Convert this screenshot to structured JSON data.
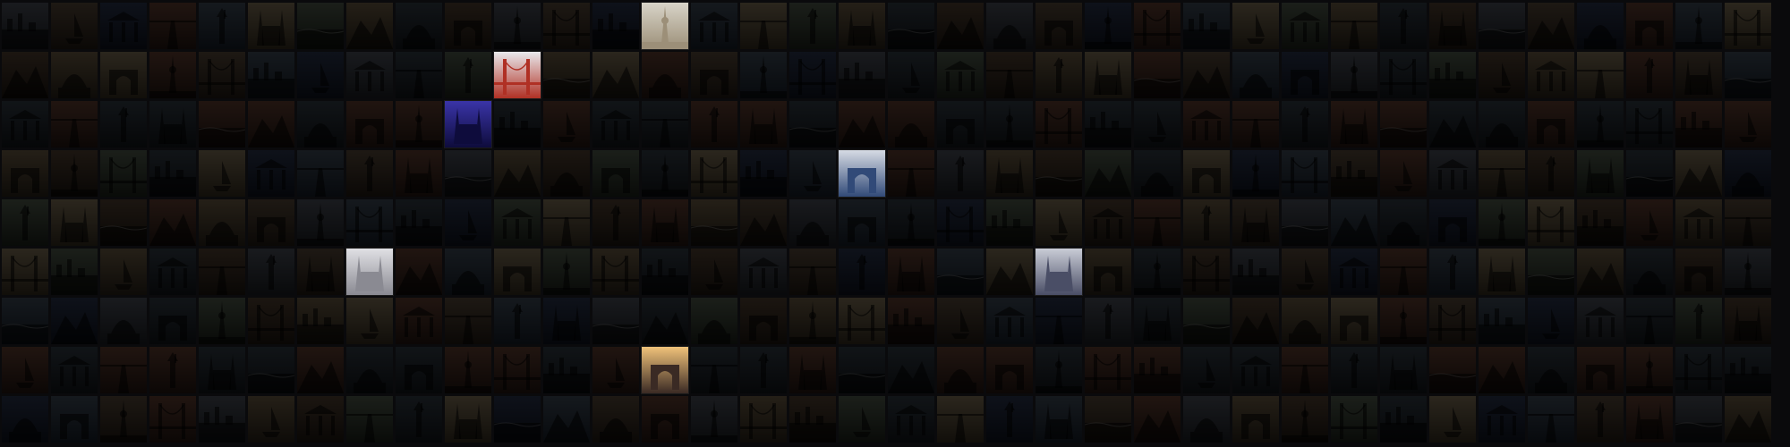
{
  "mosaic": {
    "columns": 36,
    "rows": 9,
    "palette": [
      [
        "#3a3f4a",
        "#14171c"
      ],
      [
        "#5b4a30",
        "#211a10"
      ],
      [
        "#2f3c4a",
        "#0f1722"
      ],
      [
        "#4a3a2a",
        "#1b130c"
      ],
      [
        "#26303a",
        "#0c1015"
      ],
      [
        "#6a5a3e",
        "#2a2214"
      ],
      [
        "#1f2a44",
        "#090e1a"
      ],
      [
        "#453323",
        "#17100a"
      ],
      [
        "#3e4a3a",
        "#141a12"
      ],
      [
        "#553022",
        "#1e100b"
      ]
    ],
    "subjects": [
      "city",
      "bridge",
      "tower",
      "arch",
      "dome",
      "mountain",
      "sea",
      "cathedral",
      "statue",
      "road",
      "temple",
      "boat"
    ],
    "highlighted": [
      {
        "row": 0,
        "col": 13,
        "subject": "tower",
        "colors": [
          "#d8d4c8",
          "#9c8f78"
        ]
      },
      {
        "row": 1,
        "col": 10,
        "subject": "bridge",
        "colors": [
          "#e9e9ec",
          "#b03024"
        ]
      },
      {
        "row": 2,
        "col": 9,
        "subject": "cathedral",
        "colors": [
          "#3a34a8",
          "#0e0c3c"
        ]
      },
      {
        "row": 3,
        "col": 17,
        "subject": "arch",
        "colors": [
          "#d6dbe4",
          "#314a78"
        ]
      },
      {
        "row": 5,
        "col": 7,
        "subject": "cathedral",
        "colors": [
          "#e0e0e4",
          "#8a8a92"
        ]
      },
      {
        "row": 5,
        "col": 21,
        "subject": "cathedral",
        "colors": [
          "#c9ccd6",
          "#4a4e66"
        ]
      },
      {
        "row": 7,
        "col": 13,
        "subject": "arch",
        "colors": [
          "#f0c27a",
          "#3a2a24"
        ]
      }
    ]
  }
}
